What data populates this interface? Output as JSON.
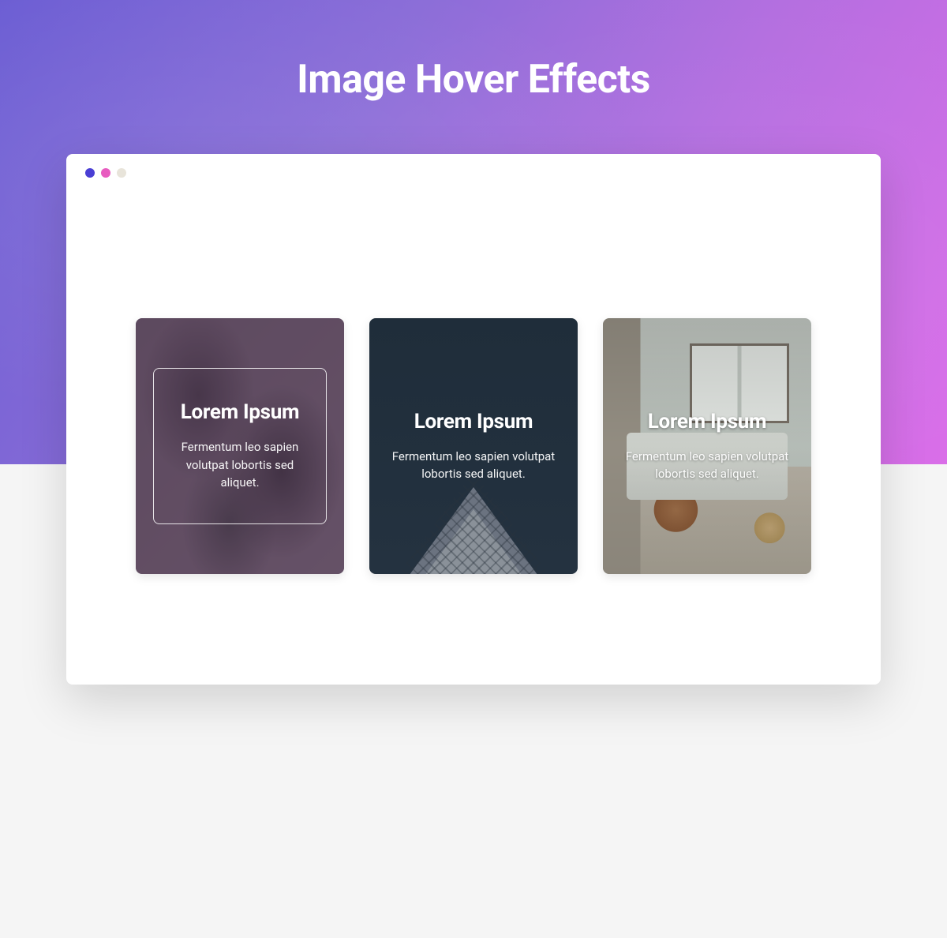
{
  "page_title": "Image Hover Effects",
  "browser_dots": [
    {
      "color": "#4a3fd4"
    },
    {
      "color": "#e85cc0"
    },
    {
      "color": "#e8e4da"
    }
  ],
  "cards": [
    {
      "title": "Lorem Ipsum",
      "description": "Fermentum leo sapien volutpat lobortis sed aliquet."
    },
    {
      "title": "Lorem Ipsum",
      "description": "Fermentum leo sapien volutpat lobortis sed aliquet."
    },
    {
      "title": "Lorem Ipsum",
      "description": "Fermentum leo sapien volutpat lobortis sed aliquet."
    }
  ]
}
